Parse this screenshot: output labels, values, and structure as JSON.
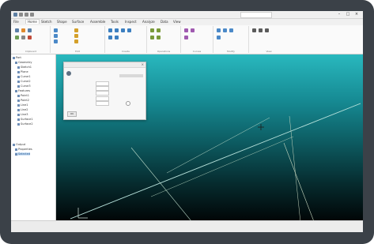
{
  "titlebar": {
    "window_title": "",
    "qat_icons": [
      "save-icon",
      "undo-icon",
      "redo-icon",
      "print-icon"
    ]
  },
  "tabs": [
    {
      "label": "File"
    },
    {
      "label": "Home",
      "active": true
    },
    {
      "label": "Sketch"
    },
    {
      "label": "Shape"
    },
    {
      "label": "Surface"
    },
    {
      "label": "Assemble"
    },
    {
      "label": "Tools"
    },
    {
      "label": "Inspect"
    },
    {
      "label": "Analyze"
    },
    {
      "label": "Data"
    },
    {
      "label": "View"
    }
  ],
  "ribbon": {
    "groups": [
      {
        "label": "Clipboard"
      },
      {
        "label": "Edit"
      },
      {
        "label": "Create"
      },
      {
        "label": "Operations"
      },
      {
        "label": "Curves"
      },
      {
        "label": "Modify"
      },
      {
        "label": "View"
      }
    ]
  },
  "tree": {
    "items": [
      {
        "label": "Part"
      },
      {
        "label": "Geometry"
      },
      {
        "label": "Sketch1"
      },
      {
        "label": "Plane"
      },
      {
        "label": "Curve1"
      },
      {
        "label": "Curve2"
      },
      {
        "label": "Curve3"
      },
      {
        "label": "Features"
      },
      {
        "label": "Point1"
      },
      {
        "label": "Point2"
      },
      {
        "label": "Line1"
      },
      {
        "label": "Line2"
      },
      {
        "label": "Line3"
      },
      {
        "label": "Surface1"
      },
      {
        "label": "Surface2"
      },
      {
        "label": "Output"
      },
      {
        "label": "Properties"
      },
      {
        "label": "Selected"
      }
    ]
  },
  "dialog": {
    "title": "",
    "heading": "",
    "subtitle": "",
    "rows": [
      {
        "label": "",
        "value": ""
      },
      {
        "label": "",
        "value": ""
      },
      {
        "label": "",
        "value": ""
      },
      {
        "label": "",
        "value": ""
      },
      {
        "label": "",
        "value": ""
      }
    ],
    "ok_label": "OK"
  },
  "statusbar": {
    "segments": [
      "",
      "",
      "",
      ""
    ]
  },
  "colors": {
    "viewport_top": "#29b8be",
    "viewport_bottom": "#010607",
    "selection": "#cce1f6",
    "accent": "#1b4f8a"
  }
}
